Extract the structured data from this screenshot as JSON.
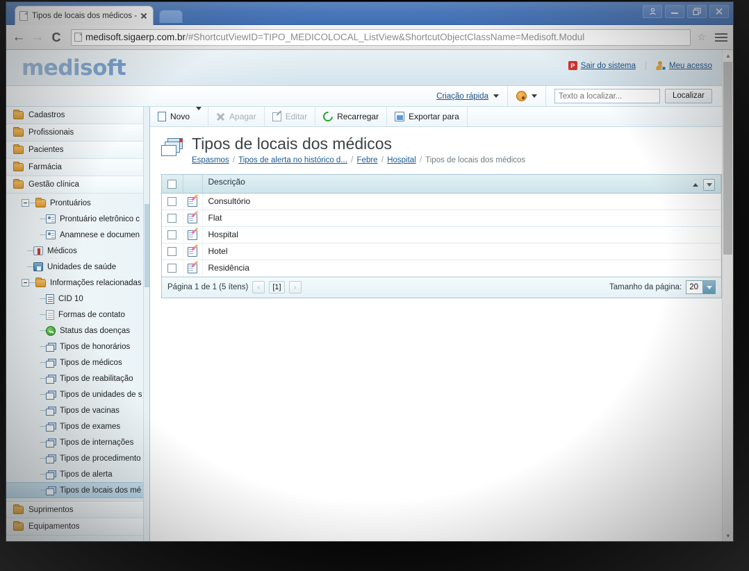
{
  "browser": {
    "tab_title": "Tipos de locais dos médicos -",
    "url_host": "medisoft.sigaerp.com.br",
    "url_path": "/#ShortcutViewID=TIPO_MEDICOLOCAL_ListView&ShortcutObjectClassName=Medisoft.Modul",
    "back_glyph": "←",
    "forward_glyph": "→",
    "reload_glyph": "C",
    "star_glyph": "☆",
    "window_controls": [
      "user-icon",
      "minimize",
      "restore",
      "close"
    ]
  },
  "app_header": {
    "logo": "medisoft",
    "links": [
      {
        "label": "Sair do sistema",
        "icon": "logout-icon"
      },
      {
        "label": "Meu acesso",
        "icon": "user-account-icon"
      }
    ]
  },
  "sub_header": {
    "quick_create": "Criação rápida",
    "theme_icon": "palette-icon",
    "search_placeholder": "Texto a localizar...",
    "search_value": "",
    "search_button": "Localizar"
  },
  "toolbar": {
    "new_label": "Novo",
    "delete_label": "Apagar",
    "edit_label": "Editar",
    "reload_label": "Recarregar",
    "export_label": "Exportar para",
    "delete_disabled": true,
    "edit_disabled": true
  },
  "page": {
    "title": "Tipos de locais dos médicos",
    "icon": "page-stack-icon",
    "breadcrumb": [
      {
        "label": "Espasmos",
        "link": true
      },
      {
        "label": "Tipos de alerta no histórico d...",
        "link": true
      },
      {
        "label": "Febre",
        "link": true
      },
      {
        "label": "Hospital",
        "link": true
      },
      {
        "label": "Tipos de locais dos médicos",
        "link": false
      }
    ],
    "breadcrumb_separator": "/"
  },
  "grid": {
    "columns": [
      "Descrição"
    ],
    "sort_indicator": "ascending",
    "rows": [
      {
        "descricao": "Consultório"
      },
      {
        "descricao": "Flat"
      },
      {
        "descricao": "Hospital"
      },
      {
        "descricao": "Hotel"
      },
      {
        "descricao": "Residência"
      }
    ],
    "pager": {
      "info": "Página 1 de 1 (5 ítens)",
      "prev": "‹",
      "current": "[1]",
      "next": "›",
      "page_size_label": "Tamanho da página:",
      "page_size_value": "20"
    }
  },
  "sidebar": {
    "roots_top": [
      {
        "label": "Cadastros"
      },
      {
        "label": "Profissionais"
      },
      {
        "label": "Pacientes"
      },
      {
        "label": "Farmácia"
      },
      {
        "label": "Gestão clínica"
      }
    ],
    "tree": [
      {
        "label": "Prontuários",
        "icon": "folder-icon",
        "level": 1,
        "expander": true
      },
      {
        "label": "Prontuário eletrônico c",
        "icon": "card-icon",
        "level": 2
      },
      {
        "label": "Anamnese e documen",
        "icon": "card-icon",
        "level": 2
      },
      {
        "label": "Médicos",
        "icon": "doctor-icon",
        "level": 1
      },
      {
        "label": "Unidades de saúde",
        "icon": "house-icon",
        "level": 1
      },
      {
        "label": "Informações relacionadas",
        "icon": "folder-icon",
        "level": 1,
        "expander": true
      },
      {
        "label": "CID 10",
        "icon": "cid-icon",
        "level": 2
      },
      {
        "label": "Formas de contato",
        "icon": "doc-icon",
        "level": 2
      },
      {
        "label": "Status das doenças",
        "icon": "status-ok-icon",
        "level": 2
      },
      {
        "label": "Tipos de honorários",
        "icon": "stack-icon",
        "level": 2
      },
      {
        "label": "Tipos de médicos",
        "icon": "stack-icon",
        "level": 2
      },
      {
        "label": "Tipos de reabilitação",
        "icon": "stack-icon",
        "level": 2
      },
      {
        "label": "Tipos de unidades de s",
        "icon": "stack-icon",
        "level": 2
      },
      {
        "label": "Tipos de vacinas",
        "icon": "stack-icon",
        "level": 2
      },
      {
        "label": "Tipos de exames",
        "icon": "stack-icon",
        "level": 2
      },
      {
        "label": "Tipos de internações",
        "icon": "stack-icon",
        "level": 2
      },
      {
        "label": "Tipos de procedimento",
        "icon": "stack-icon",
        "level": 2
      },
      {
        "label": "Tipos de alerta",
        "icon": "stack-icon",
        "level": 2
      },
      {
        "label": "Tipos de locais dos mé",
        "icon": "stack-icon",
        "level": 2,
        "selected": true
      }
    ],
    "roots_bottom": [
      {
        "label": "Suprimentos"
      },
      {
        "label": "Equipamentos"
      }
    ]
  },
  "colors": {
    "brand_blue": "#2f6fb5",
    "link_blue": "#1b5a96",
    "header_bg": "#dce9f0",
    "grid_header": "#cde4ea",
    "selected_nav": "#b9dbee",
    "chrome_blue": "#4a78ba"
  }
}
